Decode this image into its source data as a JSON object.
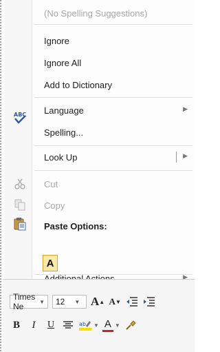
{
  "menu": {
    "no_suggestions": "(No Spelling Suggestions)",
    "ignore": "Ignore",
    "ignore_all": "Ignore All",
    "add_to_dictionary": "Add to Dictionary",
    "language": "Language",
    "spelling": "Spelling...",
    "look_up": "Look Up",
    "cut": "Cut",
    "copy": "Copy",
    "paste_options": "Paste Options:",
    "paste_keep_text": "A",
    "additional_actions": "Additional Actions"
  },
  "mini_toolbar": {
    "font_name": "Times Ne",
    "font_size": "12",
    "grow_font": "A",
    "shrink_font": "A",
    "bold": "B",
    "italic": "I",
    "underline": "U",
    "font_color_letter": "A"
  },
  "colors": {
    "highlight": "#f5e000",
    "font_color": "#d42020",
    "paste_bg": "#fde9a8"
  }
}
